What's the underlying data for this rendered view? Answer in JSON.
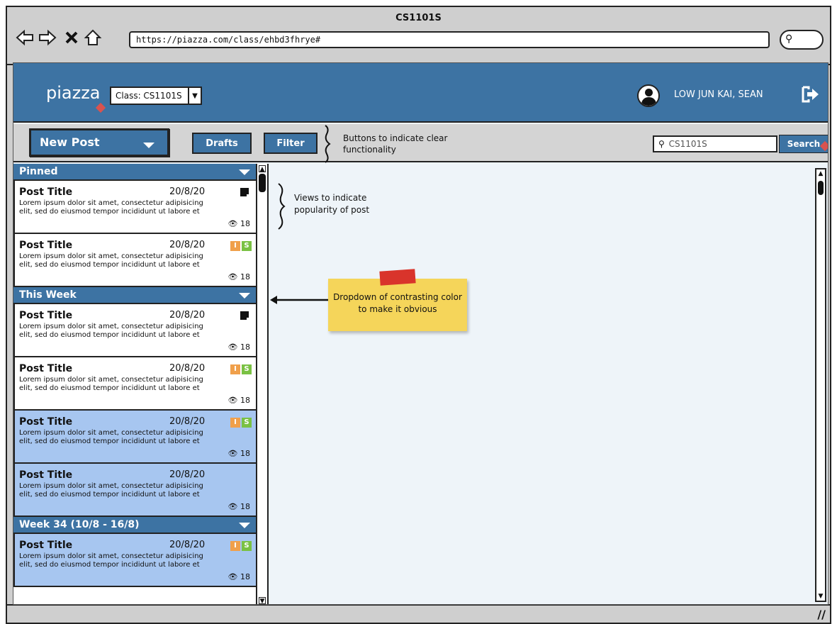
{
  "browser": {
    "window_title": "CS1101S",
    "url": "https://piazza.com/class/ehbd3fhrye#"
  },
  "header": {
    "logo": "piazza",
    "class_select": "Class: CS1101S",
    "user_name": "LOW JUN KAI, SEAN"
  },
  "toolbar": {
    "new_post": "New Post",
    "drafts": "Drafts",
    "filter": "Filter",
    "annotation": "Buttons to indicate clear functionality",
    "search_value": "CS1101S",
    "search_button": "Search"
  },
  "sections": {
    "pinned": "Pinned",
    "this_week": "This Week",
    "week34": "Week 34 (10/8 - 16/8)"
  },
  "posts": [
    {
      "title": "Post Title",
      "date": "20/8/20",
      "body": "Lorem ipsum dolor sit amet, consectetur adipisicing elit, sed do eiusmod tempor incididunt ut labore et",
      "views": "18"
    },
    {
      "title": "Post Title",
      "date": "20/8/20",
      "body": "Lorem ipsum dolor sit amet, consectetur adipisicing elit, sed do eiusmod tempor incididunt ut labore et",
      "views": "18"
    },
    {
      "title": "Post Title",
      "date": "20/8/20",
      "body": "Lorem ipsum dolor sit amet, consectetur adipisicing elit, sed do eiusmod tempor incididunt ut labore et",
      "views": "18"
    },
    {
      "title": "Post Title",
      "date": "20/8/20",
      "body": "Lorem ipsum dolor sit amet, consectetur adipisicing elit, sed do eiusmod tempor incididunt ut labore et",
      "views": "18"
    },
    {
      "title": "Post Title",
      "date": "20/8/20",
      "body": "Lorem ipsum dolor sit amet, consectetur adipisicing elit, sed do eiusmod tempor incididunt ut labore et",
      "views": "18"
    },
    {
      "title": "Post Title",
      "date": "20/8/20",
      "body": "Lorem ipsum dolor sit amet, consectetur adipisicing elit, sed do eiusmod tempor incididunt ut labore et",
      "views": "18"
    },
    {
      "title": "Post Title",
      "date": "20/8/20",
      "body": "Lorem ipsum dolor sit amet, consectetur adipisicing elit, sed do eiusmod tempor incididunt ut labore et",
      "views": "18"
    }
  ],
  "tags": {
    "i": "I",
    "s": "S"
  },
  "annotations": {
    "views": "Views to indicate popularity of post",
    "dropdown": "Dropdown of contrasting color to make it obvious"
  },
  "colors": {
    "primary": "#3d73a3",
    "selected": "#a7c6f0",
    "tag_i": "#f0a04b",
    "tag_s": "#7ac143",
    "sticky": "#f5d55a"
  }
}
